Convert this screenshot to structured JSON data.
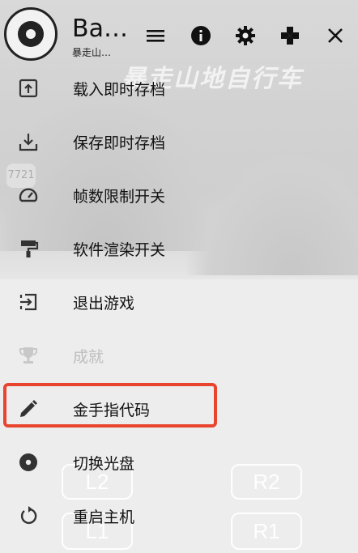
{
  "background": {
    "game_title": "暴走山地自行车",
    "score_badge": "7721",
    "buttons": {
      "l2": "L2",
      "r2": "R2",
      "l1": "L1",
      "r1": "R1"
    }
  },
  "header": {
    "title": "Ba…",
    "subtitle": "暴走山…"
  },
  "toolbar": {
    "icons": [
      "menu-icon",
      "info-icon",
      "gear-icon",
      "gamepad-icon",
      "close-icon"
    ]
  },
  "menu": {
    "items": [
      {
        "label": "载入即时存档",
        "icon": "load-state-icon",
        "enabled": true
      },
      {
        "label": "保存即时存档",
        "icon": "save-state-icon",
        "enabled": true
      },
      {
        "label": "帧数限制开关",
        "icon": "speed-gauge-icon",
        "enabled": true
      },
      {
        "label": "软件渲染开关",
        "icon": "paint-roller-icon",
        "enabled": true
      },
      {
        "label": "退出游戏",
        "icon": "exit-icon",
        "enabled": true
      },
      {
        "label": "成就",
        "icon": "trophy-icon",
        "enabled": false
      },
      {
        "label": "金手指代码",
        "icon": "pencil-icon",
        "enabled": true,
        "highlighted": true
      },
      {
        "label": "切换光盘",
        "icon": "disc-icon",
        "enabled": true
      },
      {
        "label": "重启主机",
        "icon": "restart-icon",
        "enabled": true
      }
    ]
  },
  "colors": {
    "highlight": "#e8452f",
    "disabled_text": "#bdbdbd",
    "text": "#111111"
  }
}
